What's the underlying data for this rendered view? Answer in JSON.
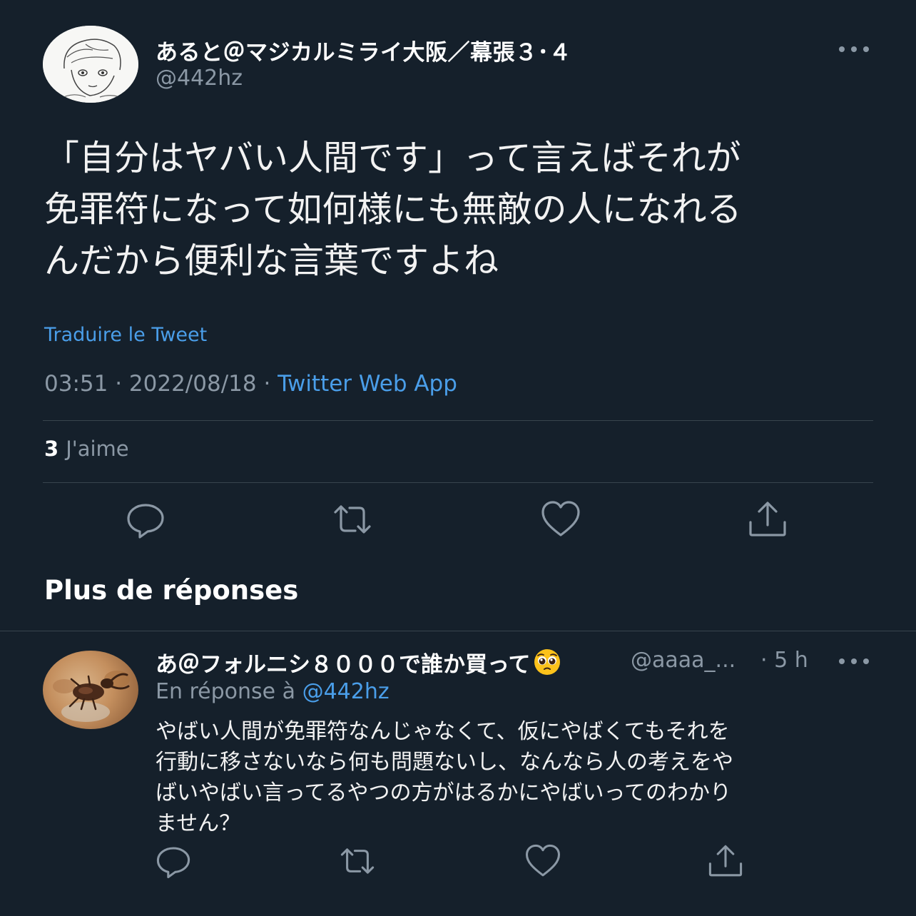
{
  "tweet": {
    "author_name": "あると＠マジカルミライ大阪／幕張３･４",
    "author_handle": "@442hz",
    "text": "「自分はヤバい人間です」って言えばそれが\n免罪符になって如何様にも無敵の人になれる\nんだから便利な言葉ですよね",
    "translate_label": "Traduire le Tweet",
    "time": "03:51",
    "date": "2022/08/18",
    "separator": " · ",
    "source": "Twitter Web App",
    "like_count": "3",
    "like_label": "J'aime",
    "more_icon": "more-horizontal-icon",
    "actions": [
      {
        "icon": "reply-icon"
      },
      {
        "icon": "retweet-icon"
      },
      {
        "icon": "heart-icon"
      },
      {
        "icon": "share-icon"
      }
    ]
  },
  "section_title": "Plus de réponses",
  "reply": {
    "author_name": "あ＠フォルニシ８０００で誰か買って",
    "author_emoji": "pleading-face-emoji",
    "author_handle": "@aaaa_...",
    "time": "· 5 h",
    "reply_prefix": "En réponse à ",
    "reply_mention": "@442hz",
    "text": "やばい人間が免罪符なんじゃなくて、仮にやばくてもそれを\n行動に移さないなら何も問題ないし、なんなら人の考えをや\nばいやばい言ってるやつの方がはるかにやばいってのわかり\nません？",
    "more_icon": "more-horizontal-icon"
  },
  "colors": {
    "background": "#15202b",
    "text": "#ffffff",
    "muted": "#8b98a5",
    "accent": "#4a9ee9",
    "divider": "#38444d"
  }
}
